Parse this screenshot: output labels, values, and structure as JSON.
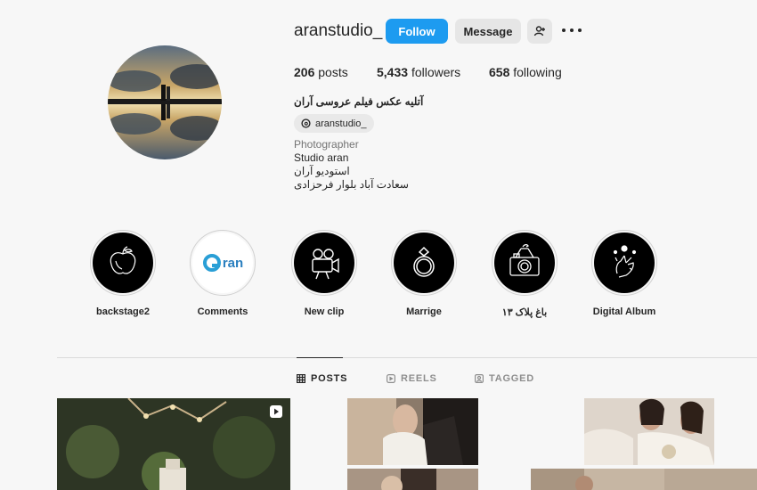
{
  "profile": {
    "username": "aranstudio_",
    "follow_label": "Follow",
    "message_label": "Message",
    "stats": {
      "posts_count": "206",
      "posts_label": "posts",
      "followers_count": "5,433",
      "followers_label": "followers",
      "following_count": "658",
      "following_label": "following"
    },
    "full_name": "آتلیه عکس فیلم عروسی آران",
    "threads_handle": "aranstudio_",
    "category": "Photographer",
    "bio_lines": [
      "Studio aran",
      "استودیو آران",
      "سعادت آباد بلوار فرحزادی"
    ]
  },
  "highlights": [
    {
      "label": "backstage2",
      "icon": "apple-sketch-icon"
    },
    {
      "label": "Comments",
      "icon": "aran-logo-icon"
    },
    {
      "label": "New clip",
      "icon": "video-camera-icon"
    },
    {
      "label": "Marrige",
      "icon": "ring-icon"
    },
    {
      "label": "باغ پلاک ۱۳",
      "icon": "camera-bird-icon"
    },
    {
      "label": "Digital Album",
      "icon": "hand-moon-icon"
    }
  ],
  "logo_text": "ran",
  "tabs": [
    {
      "label": "POSTS",
      "icon": "grid-icon",
      "active": true
    },
    {
      "label": "REELS",
      "icon": "reels-icon",
      "active": false
    },
    {
      "label": "TAGGED",
      "icon": "tagged-icon",
      "active": false
    }
  ],
  "colors": {
    "accent": "#1d9bf0",
    "background": "#f7f7f7"
  }
}
